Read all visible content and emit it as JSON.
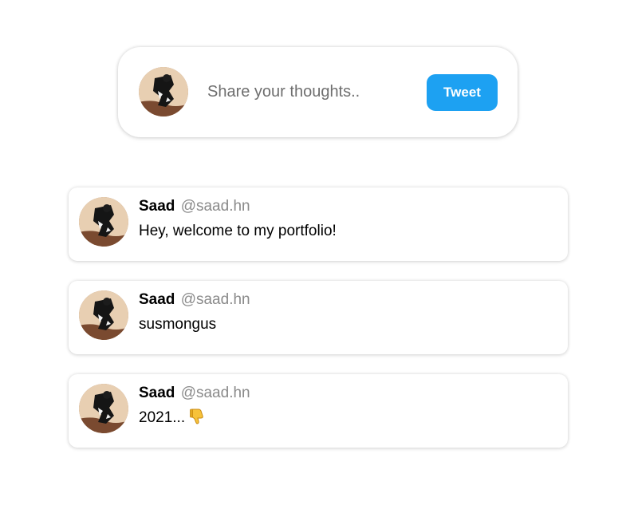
{
  "composer": {
    "placeholder": "Share your thoughts..",
    "button_label": "Tweet"
  },
  "feed": {
    "tweets": [
      {
        "name": "Saad",
        "handle": "@saad.hn",
        "text": "Hey, welcome to my portfolio!"
      },
      {
        "name": "Saad",
        "handle": "@saad.hn",
        "text": "susmongus"
      },
      {
        "name": "Saad",
        "handle": "@saad.hn",
        "text": "2021...",
        "emoji_icon": "thumbs-down-icon"
      }
    ]
  },
  "colors": {
    "accent": "#1da1f2",
    "handle": "#8a8a8a"
  }
}
